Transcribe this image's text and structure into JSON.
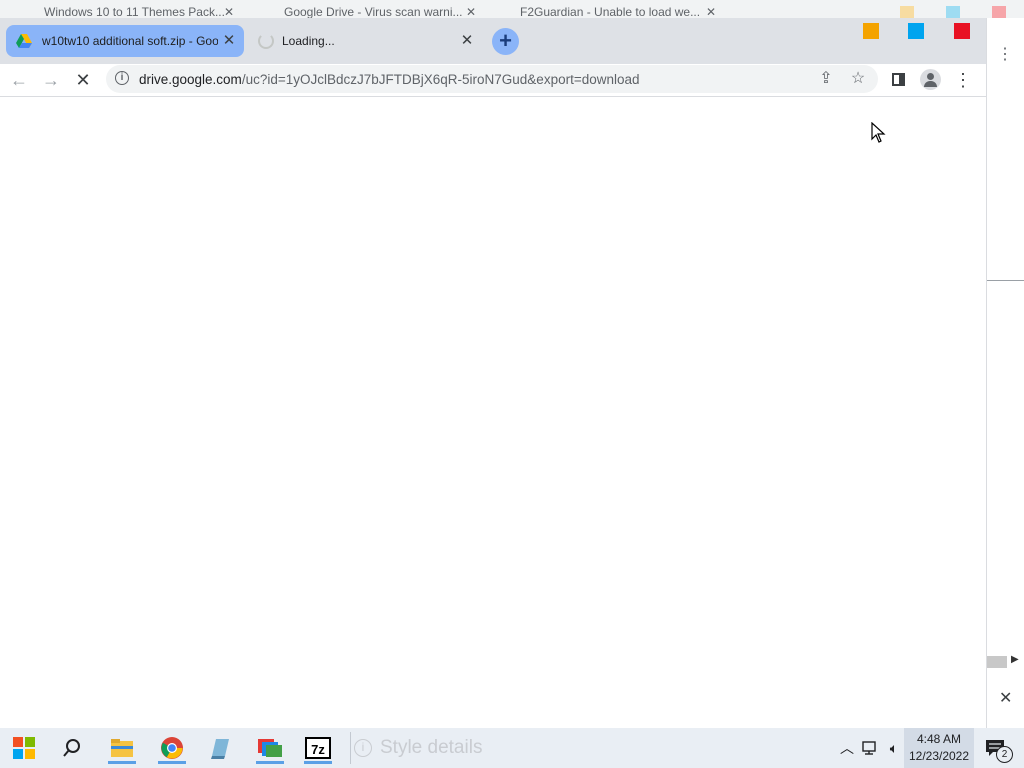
{
  "background_tabs": [
    {
      "title": "Windows 10 to 11 Themes Pack..."
    },
    {
      "title": "Google Drive - Virus scan warni..."
    },
    {
      "title": "F2Guardian - Unable to load we..."
    }
  ],
  "tabs": [
    {
      "title": "w10tw10 additional soft.zip - Goo",
      "active": true
    },
    {
      "title": "Loading...",
      "active": false
    }
  ],
  "toolbar": {
    "url_host": "drive.google.com",
    "url_path": "/uc?id=1yOJclBdczJ7bJFTDBjX6qR-5iroN7Gud&export=download"
  },
  "taskbar": {
    "search_placeholder": "Style details",
    "time": "4:48 AM",
    "date": "12/23/2022",
    "notification_count": "2"
  },
  "colors": {
    "accent": "#8ab4f8",
    "window_buttons": [
      "#f4a300",
      "#00a4ef",
      "#e81123"
    ]
  },
  "icons": [
    "drive-favicon",
    "spinner-icon",
    "close-icon",
    "plus-icon",
    "back-arrow-icon",
    "forward-arrow-icon",
    "stop-icon",
    "info-icon",
    "share-icon",
    "star-icon",
    "side-panel-icon",
    "profile-icon",
    "menu-dots-icon",
    "mouse-cursor-icon",
    "start-icon",
    "search-icon",
    "file-explorer-icon",
    "chrome-icon",
    "7zip-icon"
  ]
}
